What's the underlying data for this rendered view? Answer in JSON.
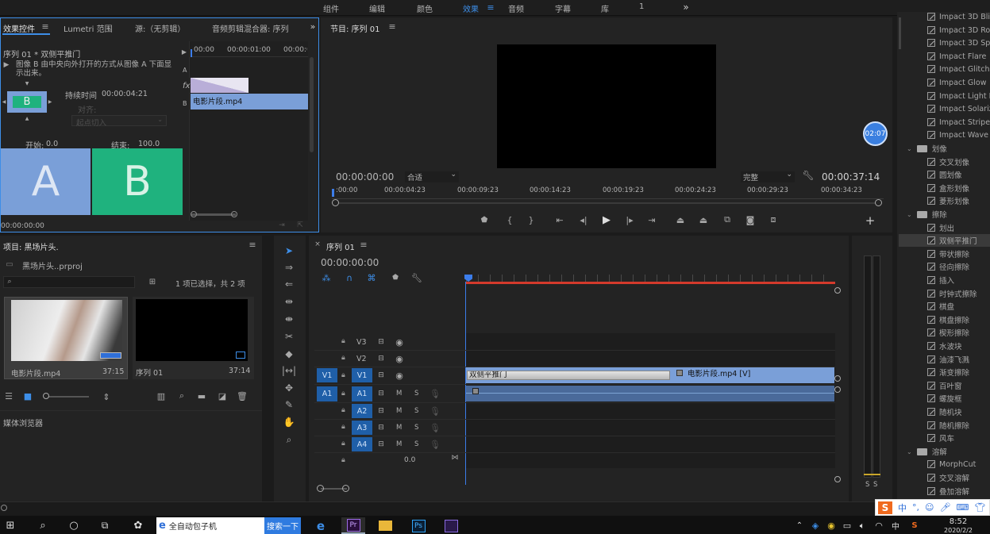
{
  "top_workspace_tabs": [
    "组件",
    "编辑",
    "颜色",
    "效果",
    "音频",
    "字幕",
    "库",
    "1"
  ],
  "top_active": "效果",
  "effect_controls": {
    "tabs": [
      "效果控件",
      "Lumetri 范围",
      "源:（无剪辑）",
      "音频剪辑混合器: 序列"
    ],
    "sequence_label": "序列 01 * 双侧平推门",
    "description": "图像 B 由中央向外打开的方式从图像 A 下面显示出来。",
    "duration_label": "持续时间",
    "duration_value": "00:00:04:21",
    "align_label": "对齐:",
    "align_value": "起点切入",
    "start_label": "开始:",
    "start_value": "0.0",
    "end_label": "结束:",
    "end_value": "100.0",
    "preview_a": "A",
    "preview_b": "B",
    "mini_b": "B",
    "timecode": "00:00:00:00",
    "ruler": [
      "00:00",
      "00:00:01:00",
      "00:00:0"
    ],
    "track_a": "A",
    "track_b": "B",
    "clip_name": "电影片段.mp4"
  },
  "program": {
    "title": "节目: 序列 01",
    "timecode": "00:00:00:00",
    "fit": "合适",
    "quality": "完整",
    "duration": "00:00:37:14",
    "ruler": [
      ":00:00",
      "00:00:04:23",
      "00:00:09:23",
      "00:00:14:23",
      "00:00:19:23",
      "00:00:24:23",
      "00:00:29:23",
      "00:00:34:23"
    ],
    "badge": "02:07"
  },
  "project": {
    "title": "项目: 黑场片头.",
    "file": "黑场片头..prproj",
    "selection_info": "1 项已选择，共 2 项",
    "items": [
      {
        "name": "电影片段.mp4",
        "duration": "37:15"
      },
      {
        "name": "序列 01",
        "duration": "37:14"
      }
    ],
    "media_browser": "媒体浏览器"
  },
  "timeline": {
    "tab": "序列 01",
    "timecode": "00:00:00:00",
    "video_tracks": [
      "V3",
      "V2",
      "V1"
    ],
    "audio_tracks": [
      "A1",
      "A2",
      "A3",
      "A4"
    ],
    "src_v": "V1",
    "src_a": "A1",
    "m": "M",
    "s": "S",
    "master_value": "0.0",
    "transition_name": "双侧平推门",
    "clip_name": "电影片段.mp4 [V]"
  },
  "meter": {
    "labels": [
      "S",
      "S"
    ]
  },
  "effects_panel": {
    "impact_items": [
      "Impact 3D Blinds",
      "Impact 3D Roll",
      "Impact 3D Spin",
      "Impact Flare",
      "Impact Glitch",
      "Impact Glow",
      "Impact Light Le",
      "Impact Solarize",
      "Impact Stripes",
      "Impact Wave"
    ],
    "folders": [
      {
        "name": "划像",
        "items": [
          "交叉划像",
          "圆划像",
          "盒形划像",
          "菱形划像"
        ]
      },
      {
        "name": "擦除",
        "items": [
          "划出",
          "双侧平推门",
          "带状擦除",
          "径向擦除",
          "插入",
          "时钟式擦除",
          "棋盘",
          "棋盘擦除",
          "楔形擦除",
          "水波块",
          "油漆飞溅",
          "渐变擦除",
          "百叶窗",
          "螺旋框",
          "随机块",
          "随机擦除",
          "风车"
        ]
      },
      {
        "name": "溶解",
        "items": [
          "MorphCut",
          "交叉溶解",
          "叠加溶解"
        ]
      }
    ],
    "selected": "双侧平推门"
  },
  "ime": {
    "label": "中"
  },
  "taskbar": {
    "search_text": "全自动包子机",
    "search_button": "搜索一下",
    "clock_time": "8:52",
    "clock_date": "2020/2/2",
    "ime_lang": "中"
  },
  "colors": {
    "accent_blue": "#3d8ee8",
    "clip_blue": "#7a9fd8",
    "preview_a": "#7a9fd8",
    "preview_b": "#1fb27e",
    "playhead": "#3c7dea",
    "work_area": "#d43a2c"
  }
}
